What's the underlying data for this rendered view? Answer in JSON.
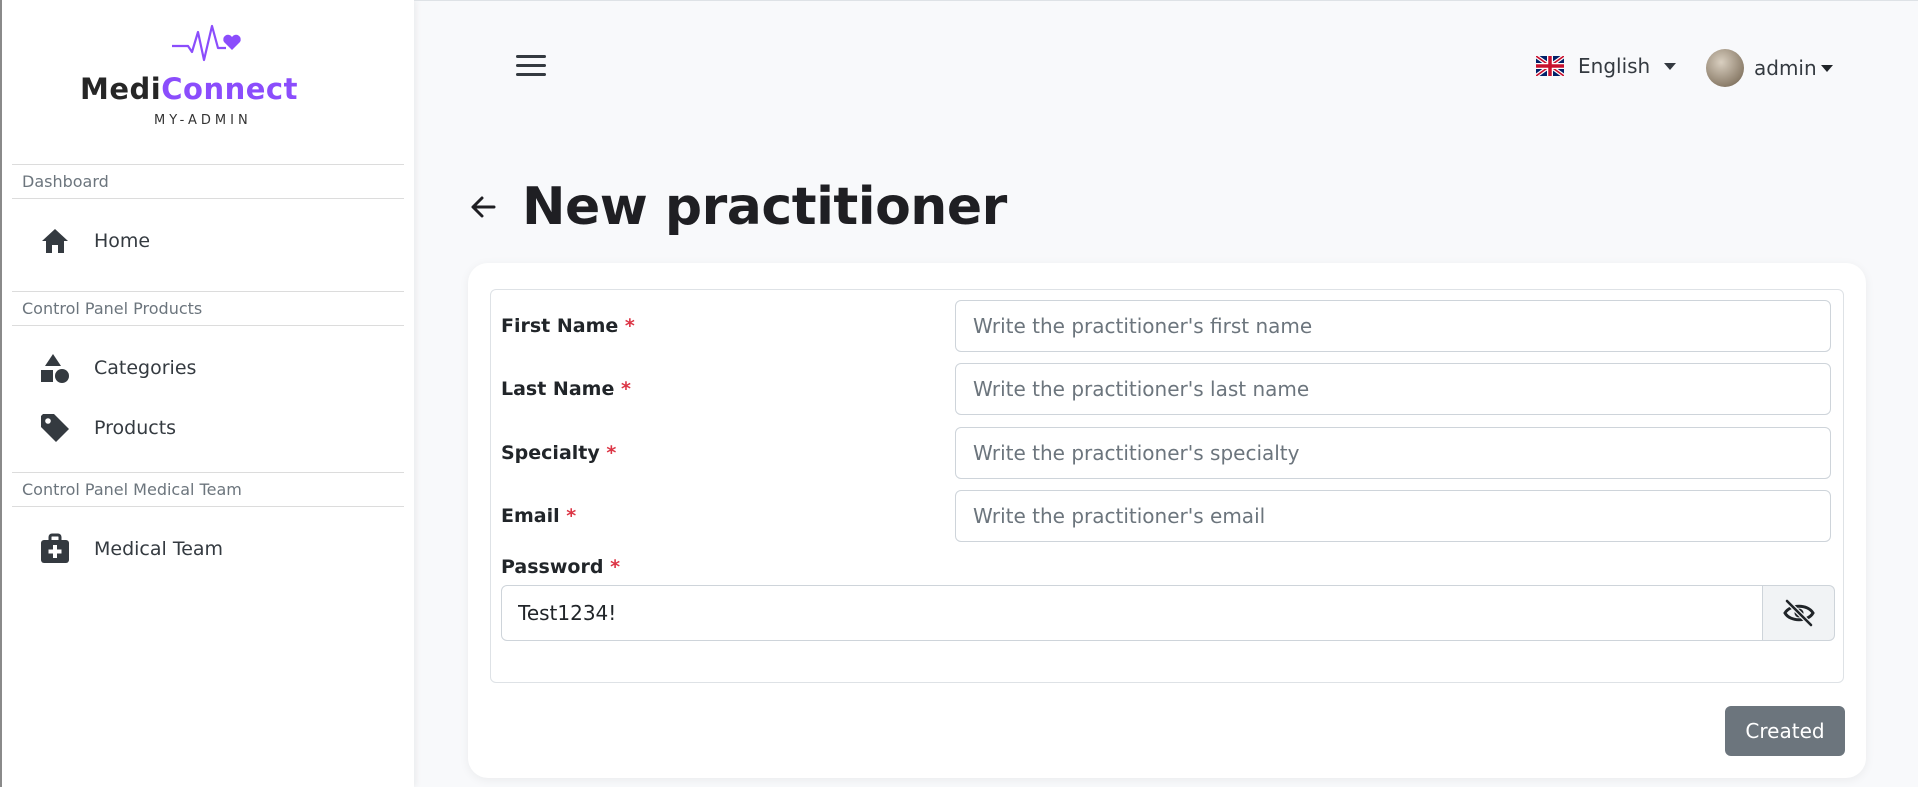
{
  "brand": {
    "name_part1": "Medi",
    "name_part2": "Connect",
    "subtitle": "MY-ADMIN",
    "accent_color": "#8b4dfc"
  },
  "sidebar": {
    "sections": [
      {
        "title": "Dashboard",
        "items": [
          {
            "label": "Home",
            "icon": "home-icon"
          }
        ]
      },
      {
        "title": "Control Panel Products",
        "items": [
          {
            "label": "Categories",
            "icon": "shapes-icon"
          },
          {
            "label": "Products",
            "icon": "tag-icon"
          }
        ]
      },
      {
        "title": "Control Panel Medical Team",
        "items": [
          {
            "label": "Medical Team",
            "icon": "medkit-icon"
          }
        ]
      }
    ]
  },
  "header": {
    "language": "English",
    "user": "admin"
  },
  "page": {
    "title": "New practitioner"
  },
  "form": {
    "required_mark": "*",
    "first_name": {
      "label": "First Name",
      "placeholder": "Write the practitioner's first name",
      "value": ""
    },
    "last_name": {
      "label": "Last Name",
      "placeholder": "Write the practitioner's last name",
      "value": ""
    },
    "specialty": {
      "label": "Specialty",
      "placeholder": "Write the practitioner's specialty",
      "value": ""
    },
    "email": {
      "label": "Email",
      "placeholder": "Write the practitioner's email",
      "value": ""
    },
    "password": {
      "label": "Password",
      "value": "Test1234!",
      "toggle_icon": "eye-slash-icon"
    },
    "submit_label": "Created"
  }
}
